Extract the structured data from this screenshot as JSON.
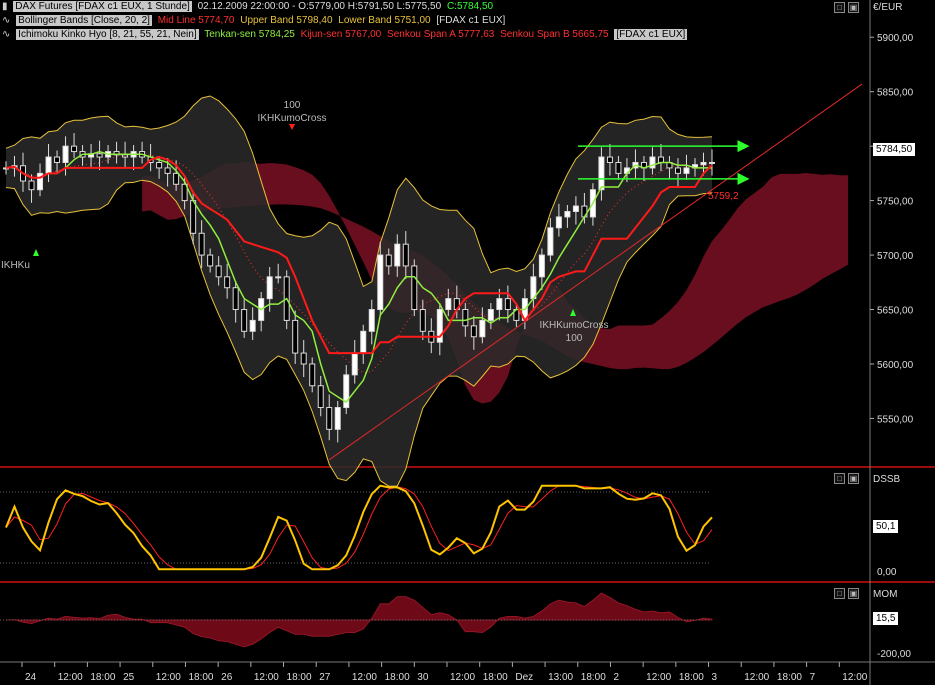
{
  "legend": {
    "line1": {
      "instrument": "DAX Futures [FDAX c1 EUX, 1 Stunde]",
      "ohlc": "02.12.2009 22:00:00 - O:5779,00 H:5791,50 L:5775,50",
      "close": "C:5784,50"
    },
    "line2": {
      "name": "Bollinger Bands [Close, 20, 2]",
      "mid": "Mid Line 5774,70",
      "upper": "Upper Band 5798,40",
      "lower": "Lower Band 5751,00",
      "tail": "[FDAX c1 EUX]"
    },
    "line3": {
      "name": "Ichimoku Kinko Hyo [8, 21, 55, 21, Nein]",
      "tenkan": "Tenkan-sen 5784,25",
      "kijun": "Kijun-sen 5767,00",
      "spanA": "Senkou Span A 5777,63",
      "spanB": "Senkou Span B 5665,75",
      "tail": "[FDAX c1 EUX]"
    }
  },
  "axis": {
    "currency": "€/EUR",
    "price_ticks": [
      "5900,00",
      "5850,00",
      "5800,00",
      "5750,00",
      "5700,00",
      "5650,00",
      "5600,00",
      "5550,00"
    ],
    "last_price": "5784,50",
    "dssb_ticks": [
      "0,00"
    ],
    "dssb_value": "50,1",
    "mom_ticks": [
      "-200,00"
    ],
    "mom_value": "15,5",
    "time_labels": [
      "24",
      "12:00",
      "18:00",
      "25",
      "12:00",
      "18:00",
      "26",
      "12:00",
      "18:00",
      "27",
      "12:00",
      "18:00",
      "30",
      "12:00",
      "18:00",
      "Dez",
      "13:00",
      "18:00",
      "2",
      "12:00",
      "18:00",
      "3",
      "12:00",
      "18:00",
      "7",
      "12:00"
    ]
  },
  "panels": {
    "dssb": "DSSB",
    "mom": "MOM"
  },
  "annotations": {
    "cross_top_count": "100",
    "cross_top_label": "IKHKumoCross",
    "cross_bottom_label": "IKHKumoCross",
    "cross_bottom_count": "100",
    "cross_left_label": "IKHKu",
    "target_label": "5759,2"
  },
  "colors": {
    "bull": "#ffffff",
    "bear": "#000000",
    "tenkan": "#90ee40",
    "kijun": "#ff1a1a",
    "bollinger": "#e8c23a",
    "cloud": "#7a1024",
    "dssb_fast": "#ffc400",
    "dssb_slow": "#ff2020",
    "mom_fill": "#6e0a18",
    "trendline": "#e02828",
    "arrow": "#2cff2c"
  },
  "chart_data": {
    "type": "candlestick",
    "title": "DAX Futures [FDAX c1 EUX, 1 Stunde]",
    "ylim": [
      5510,
      5925
    ],
    "close_series": [
      5780,
      5782,
      5768,
      5760,
      5775,
      5790,
      5785,
      5800,
      5795,
      5790,
      5793,
      5790,
      5795,
      5792,
      5790,
      5795,
      5790,
      5785,
      5780,
      5775,
      5765,
      5750,
      5720,
      5700,
      5690,
      5680,
      5670,
      5650,
      5630,
      5640,
      5660,
      5680,
      5680,
      5640,
      5610,
      5600,
      5580,
      5560,
      5540,
      5560,
      5590,
      5610,
      5630,
      5650,
      5700,
      5690,
      5710,
      5690,
      5650,
      5630,
      5620,
      5650,
      5660,
      5650,
      5635,
      5625,
      5640,
      5650,
      5660,
      5650,
      5640,
      5660,
      5680,
      5700,
      5725,
      5735,
      5740,
      5745,
      5735,
      5760,
      5790,
      5785,
      5775,
      5780,
      5785,
      5780,
      5790,
      5785,
      5780,
      5775,
      5780,
      5783,
      5785,
      5785
    ],
    "kumo_cross_markers": [
      {
        "x": "26 (Nov)",
        "label": "IKHKumoCross",
        "count": 100
      },
      {
        "x": "Dez 1",
        "label": "IKHKumoCross",
        "count": 100
      }
    ],
    "target_price": 5759.2
  }
}
